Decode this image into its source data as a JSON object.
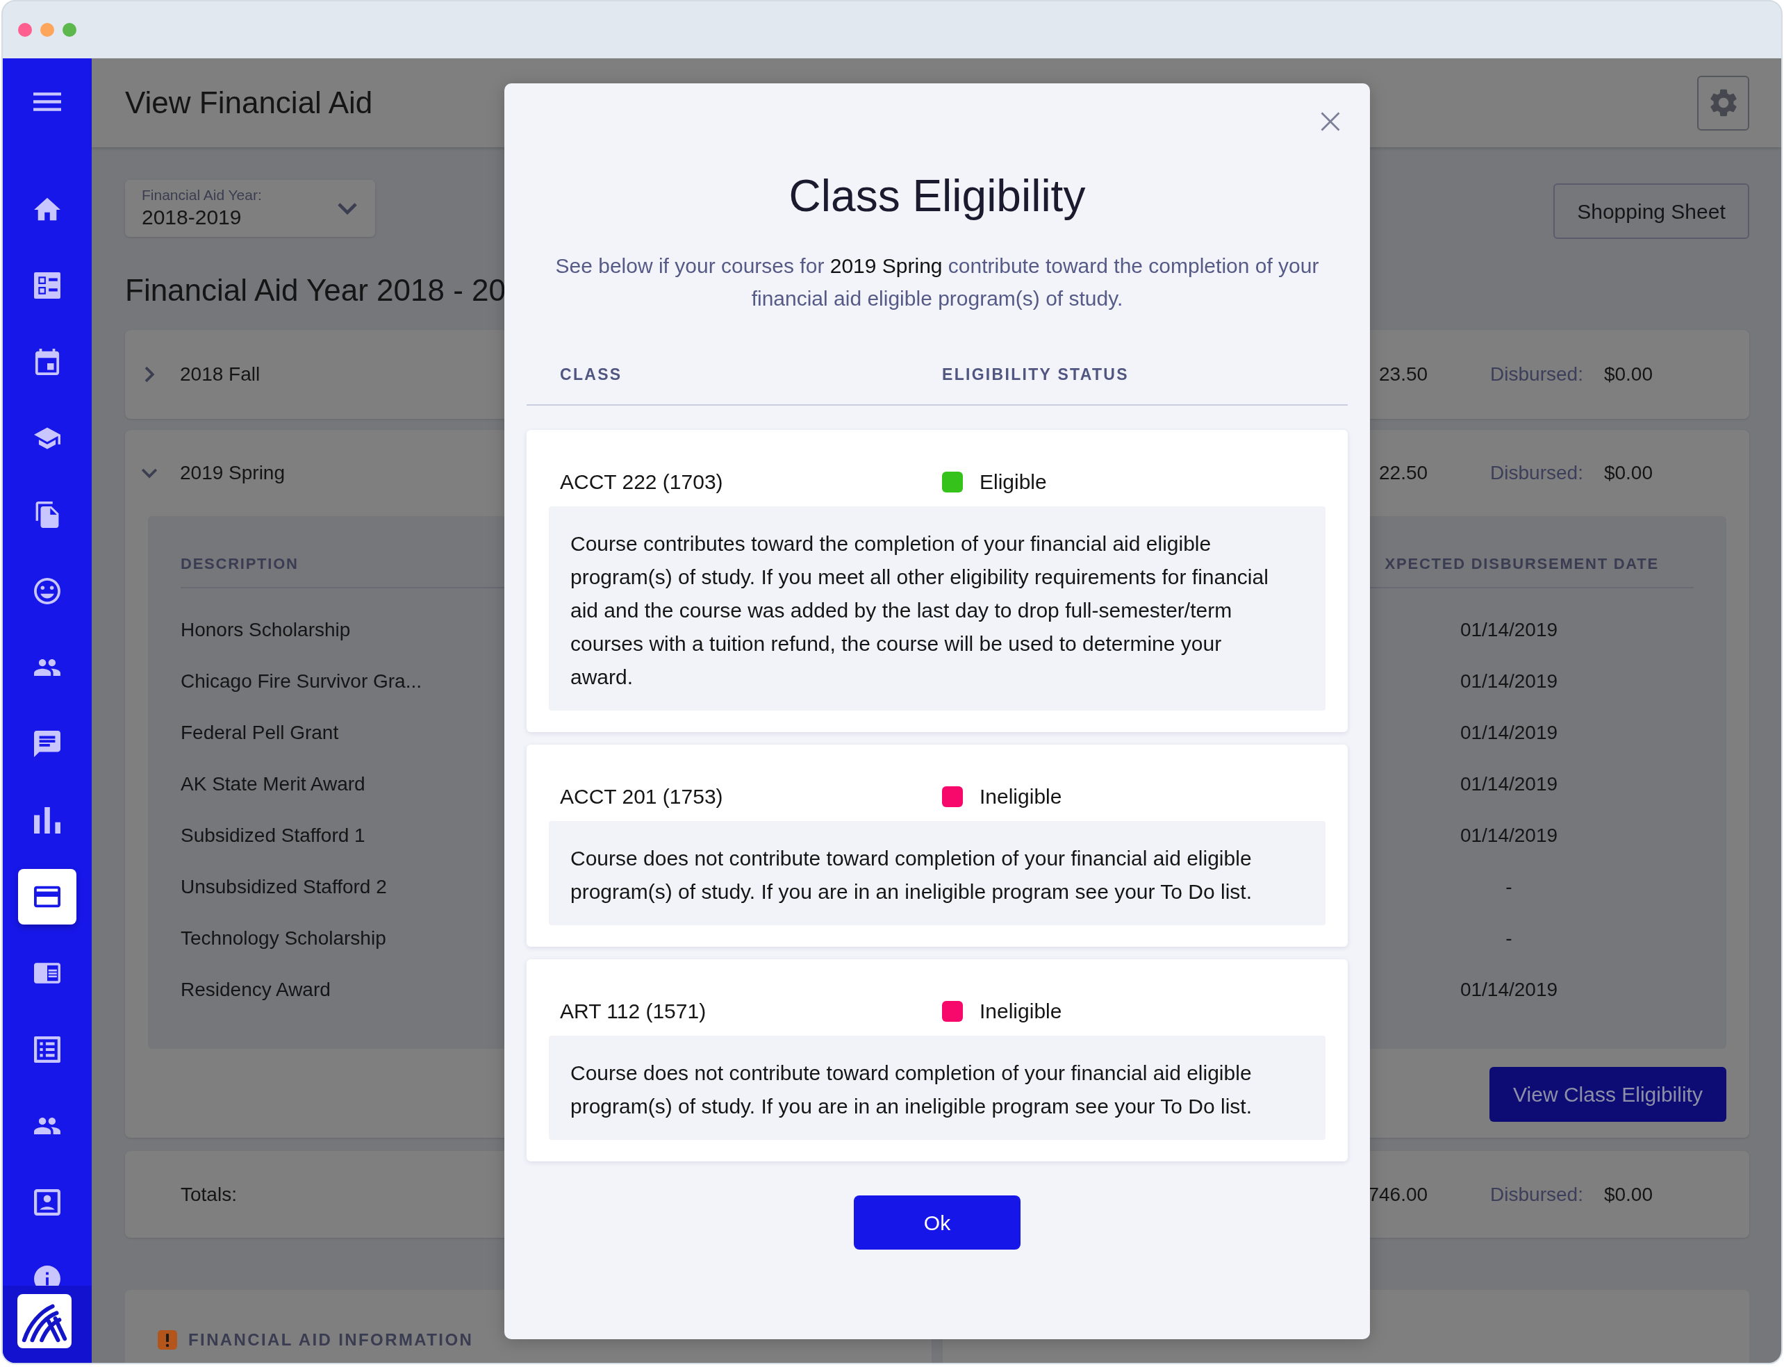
{
  "window": {
    "controls": [
      {
        "color": "#fe5f8f"
      },
      {
        "color": "#fea55c"
      },
      {
        "color": "#5cb84c"
      }
    ]
  },
  "sidebar": {
    "items": [
      {
        "selected": false
      },
      {
        "selected": false
      },
      {
        "selected": false
      },
      {
        "selected": false
      },
      {
        "selected": false
      },
      {
        "selected": false
      },
      {
        "selected": false
      },
      {
        "selected": false
      },
      {
        "selected": false
      },
      {
        "selected": true
      },
      {
        "selected": false
      },
      {
        "selected": false
      },
      {
        "selected": false
      },
      {
        "selected": false
      },
      {
        "selected": false
      }
    ]
  },
  "header": {
    "title": "View Financial Aid"
  },
  "year_select": {
    "label": "Financial Aid Year:",
    "value": "2018-2019"
  },
  "shopping_sheet_button": "Shopping Sheet",
  "heading": "Financial Aid Year 2018 - 20",
  "terms": [
    {
      "name": "2018 Fall",
      "expanded": false,
      "amount": "23.50",
      "disbursed_label": "Disbursed:",
      "disbursed": "$0.00"
    },
    {
      "name": "2019 Spring",
      "expanded": true,
      "amount": "22.50",
      "disbursed_label": "Disbursed:",
      "disbursed": "$0.00",
      "table": {
        "columns": [
          "DESCRIPTION",
          "XPECTED DISBURSEMENT DATE"
        ],
        "rows": [
          {
            "description": "Honors Scholarship",
            "date": "01/14/2019"
          },
          {
            "description": "Chicago Fire Survivor Gra...",
            "date": "01/14/2019"
          },
          {
            "description": "Federal Pell Grant",
            "date": "01/14/2019"
          },
          {
            "description": "AK State Merit Award",
            "date": "01/14/2019"
          },
          {
            "description": "Subsidized Stafford 1",
            "date": "01/14/2019"
          },
          {
            "description": "Unsubsidized Stafford 2",
            "date": "-"
          },
          {
            "description": "Technology Scholarship",
            "date": "-"
          },
          {
            "description": "Residency Award",
            "date": "01/14/2019"
          }
        ]
      },
      "button": "View Class Eligibility"
    }
  ],
  "totals": {
    "label": "Totals:",
    "amount": "746.00",
    "disbursed_label": "Disbursed:",
    "disbursed": "$0.00"
  },
  "panels": [
    {
      "kind": "titled",
      "title": "FINANCIAL AID INFORMATION"
    },
    {
      "kind": "blank"
    }
  ],
  "modal": {
    "title": "Class Eligibility",
    "intro": "See below if your courses for **2019 Spring** contribute toward the completion of your financial aid eligible program(s) of study.",
    "columns": [
      "CLASS",
      "ELIGIBILITY STATUS"
    ],
    "classes": [
      {
        "name": "ACCT 222 (1703)",
        "status": "Eligible",
        "color": "#35c21a",
        "description": "Course contributes toward the completion of your financial aid eligible program(s) of study. If you meet all other eligibility requirements for financial aid and the course was added by the last day to drop full-semester/term courses with a tuition refund, the course will be used to determine your award."
      },
      {
        "name": "ACCT 201 (1753)",
        "status": "Ineligible",
        "color": "#f7086b",
        "description": "Course does not contribute toward completion of your financial aid eligible program(s) of study. If you are in an ineligible program see your To Do list."
      },
      {
        "name": "ART 112 (1571)",
        "status": "Ineligible",
        "color": "#f7086b",
        "description": "Course does not contribute toward completion of your financial aid eligible program(s) of study. If you are in an ineligible program see your To Do list."
      }
    ],
    "ok_button": "Ok"
  }
}
